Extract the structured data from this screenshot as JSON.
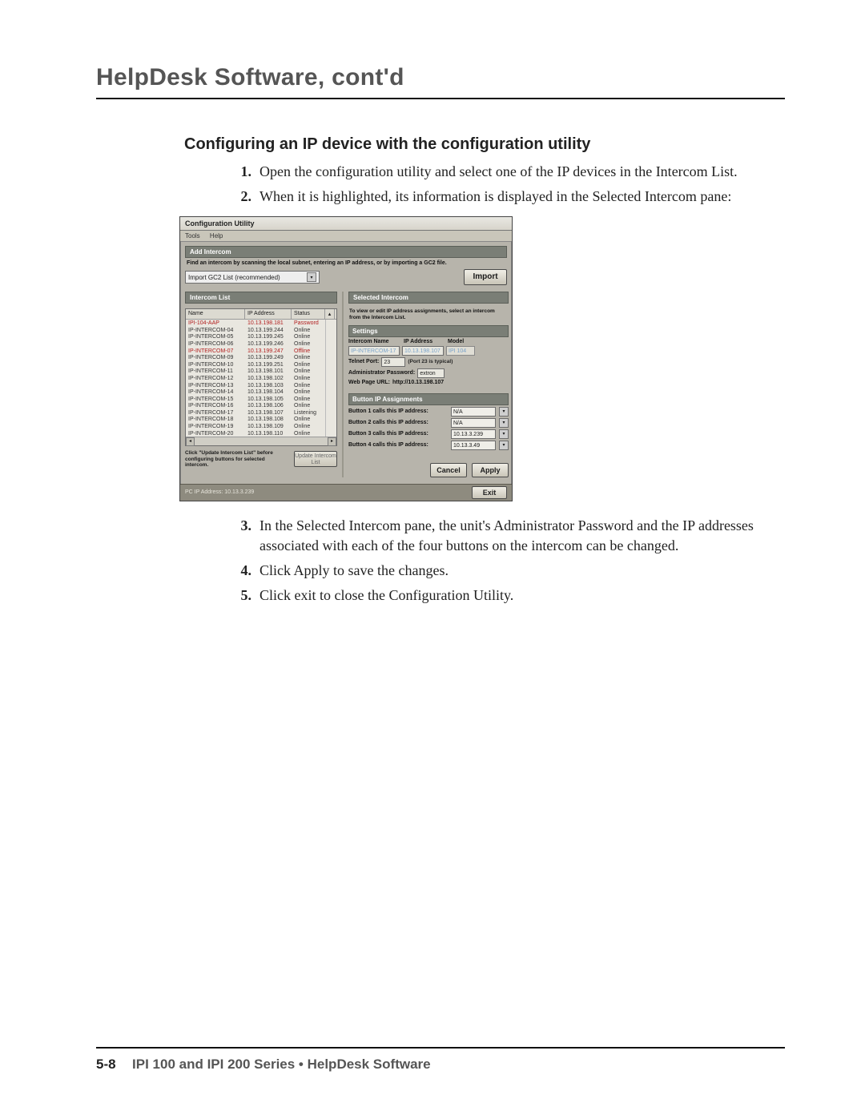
{
  "header": {
    "title": "HelpDesk Software, cont'd"
  },
  "section": {
    "title": "Configuring an IP device with the configuration utility"
  },
  "steps": [
    {
      "num": "1.",
      "text": "Open the configuration utility and select one of the IP devices in the Intercom List."
    },
    {
      "num": "2.",
      "text": "When it is highlighted, its information is displayed in the Selected Intercom pane:"
    },
    {
      "num": "3.",
      "text": "In the Selected Intercom pane, the unit's Administrator Password and the IP addresses associated with each of the four buttons on the intercom can be changed."
    },
    {
      "num": "4.",
      "text": "Click Apply to save the changes."
    },
    {
      "num": "5.",
      "text": "Click exit to close the Configuration Utility."
    }
  ],
  "util": {
    "title": "Configuration Utility",
    "menu": {
      "tools": "Tools",
      "help": "Help"
    },
    "add": {
      "header": "Add Intercom",
      "desc": "Find an intercom by scanning the local subnet, entering an IP address, or by importing a GC2 file.",
      "select": "Import GC2 List (recommended)",
      "import": "Import"
    },
    "listHeader": "Intercom List",
    "cols": {
      "name": "Name",
      "ip": "IP Address",
      "status": "Status"
    },
    "rows": [
      {
        "name": "IPI-104-AAP",
        "ip": "10.13.198.181",
        "status": "Password",
        "offline": true
      },
      {
        "name": "IP-INTERCOM-04",
        "ip": "10.13.199.244",
        "status": "Online"
      },
      {
        "name": "IP-INTERCOM-05",
        "ip": "10.13.199.245",
        "status": "Online"
      },
      {
        "name": "IP-INTERCOM-06",
        "ip": "10.13.199.246",
        "status": "Online"
      },
      {
        "name": "IP-INTERCOM-07",
        "ip": "10.13.199.247",
        "status": "Offline",
        "offline": true
      },
      {
        "name": "IP-INTERCOM-09",
        "ip": "10.13.199.249",
        "status": "Online"
      },
      {
        "name": "IP-INTERCOM-10",
        "ip": "10.13.199.251",
        "status": "Online"
      },
      {
        "name": "IP-INTERCOM-11",
        "ip": "10.13.198.101",
        "status": "Online"
      },
      {
        "name": "IP-INTERCOM-12",
        "ip": "10.13.198.102",
        "status": "Online"
      },
      {
        "name": "IP-INTERCOM-13",
        "ip": "10.13.198.103",
        "status": "Online"
      },
      {
        "name": "IP-INTERCOM-14",
        "ip": "10.13.198.104",
        "status": "Online"
      },
      {
        "name": "IP-INTERCOM-15",
        "ip": "10.13.198.105",
        "status": "Online"
      },
      {
        "name": "IP-INTERCOM-16",
        "ip": "10.13.198.106",
        "status": "Online"
      },
      {
        "name": "IP-INTERCOM-17",
        "ip": "10.13.198.107",
        "status": "Listening"
      },
      {
        "name": "IP-INTERCOM-18",
        "ip": "10.13.198.108",
        "status": "Online"
      },
      {
        "name": "IP-INTERCOM-19",
        "ip": "10.13.198.109",
        "status": "Online"
      },
      {
        "name": "IP-INTERCOM-20",
        "ip": "10.13.198.110",
        "status": "Online"
      }
    ],
    "leftNote": "Click \"Update Intercom List\" before configuring buttons for selected intercom.",
    "updateBtn": "Update Intercom List",
    "right": {
      "header": "Selected Intercom",
      "desc": "To view or edit IP address assignments, select an intercom from the Intercom List.",
      "settingsHeader": "Settings",
      "intercomNameLabel": "Intercom Name",
      "intercomNameValue": "IP-INTERCOM-17",
      "ipAddressLabel": "IP Address",
      "ipAddressValue": "10.13.198.107",
      "modelLabel": "Model",
      "modelValue": "IPI 104",
      "telnetLabel": "Telnet Port:",
      "telnetValue": "23",
      "telnetHint": "(Port 23 is typical)",
      "adminPwLabel": "Administrator Password:",
      "adminPwValue": "extron",
      "webLabel": "Web Page URL:",
      "webValue": "http://10.13.198.107",
      "bipHeader": "Button IP Assignments",
      "bip": [
        {
          "label": "Button 1 calls this IP address:",
          "value": "N/A"
        },
        {
          "label": "Button 2 calls this IP address:",
          "value": "N/A"
        },
        {
          "label": "Button 3 calls this IP address:",
          "value": "10.13.3.239"
        },
        {
          "label": "Button 4 calls this IP address:",
          "value": "10.13.3.49"
        }
      ],
      "cancel": "Cancel",
      "apply": "Apply"
    },
    "status": "PC IP Address: 10.13.3.239",
    "exit": "Exit"
  },
  "footer": {
    "page": "5-8",
    "text": "IPI 100 and IPI 200 Series • HelpDesk Software"
  }
}
